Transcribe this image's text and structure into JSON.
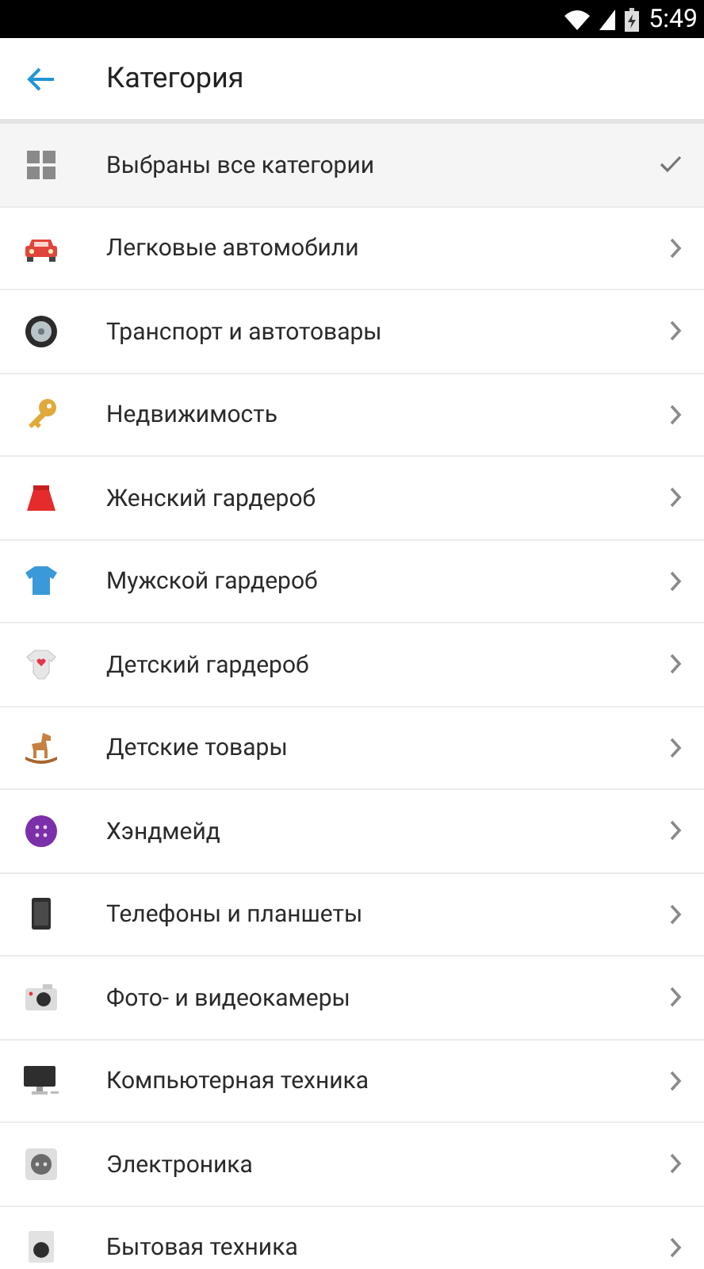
{
  "status_bar": {
    "time": "5:49"
  },
  "toolbar": {
    "title": "Категория"
  },
  "items": [
    {
      "label": "Выбраны все категории",
      "kind": "grid",
      "selected": true
    },
    {
      "label": "Легковые автомобили",
      "kind": "car",
      "selected": false
    },
    {
      "label": "Транспорт и автотовары",
      "kind": "wheel",
      "selected": false
    },
    {
      "label": "Недвижимость",
      "kind": "key",
      "selected": false
    },
    {
      "label": "Женский гардероб",
      "kind": "skirt",
      "selected": false
    },
    {
      "label": "Мужской гардероб",
      "kind": "tshirt",
      "selected": false
    },
    {
      "label": "Детский гардероб",
      "kind": "bodysuit",
      "selected": false
    },
    {
      "label": "Детские товары",
      "kind": "horse",
      "selected": false
    },
    {
      "label": "Хэндмейд",
      "kind": "button",
      "selected": false
    },
    {
      "label": "Телефоны и планшеты",
      "kind": "phone",
      "selected": false
    },
    {
      "label": "Фото- и видеокамеры",
      "kind": "camera",
      "selected": false
    },
    {
      "label": "Компьютерная техника",
      "kind": "monitor",
      "selected": false
    },
    {
      "label": "Электроника",
      "kind": "socket",
      "selected": false
    },
    {
      "label": "Бытовая техника",
      "kind": "washer",
      "selected": false
    }
  ]
}
